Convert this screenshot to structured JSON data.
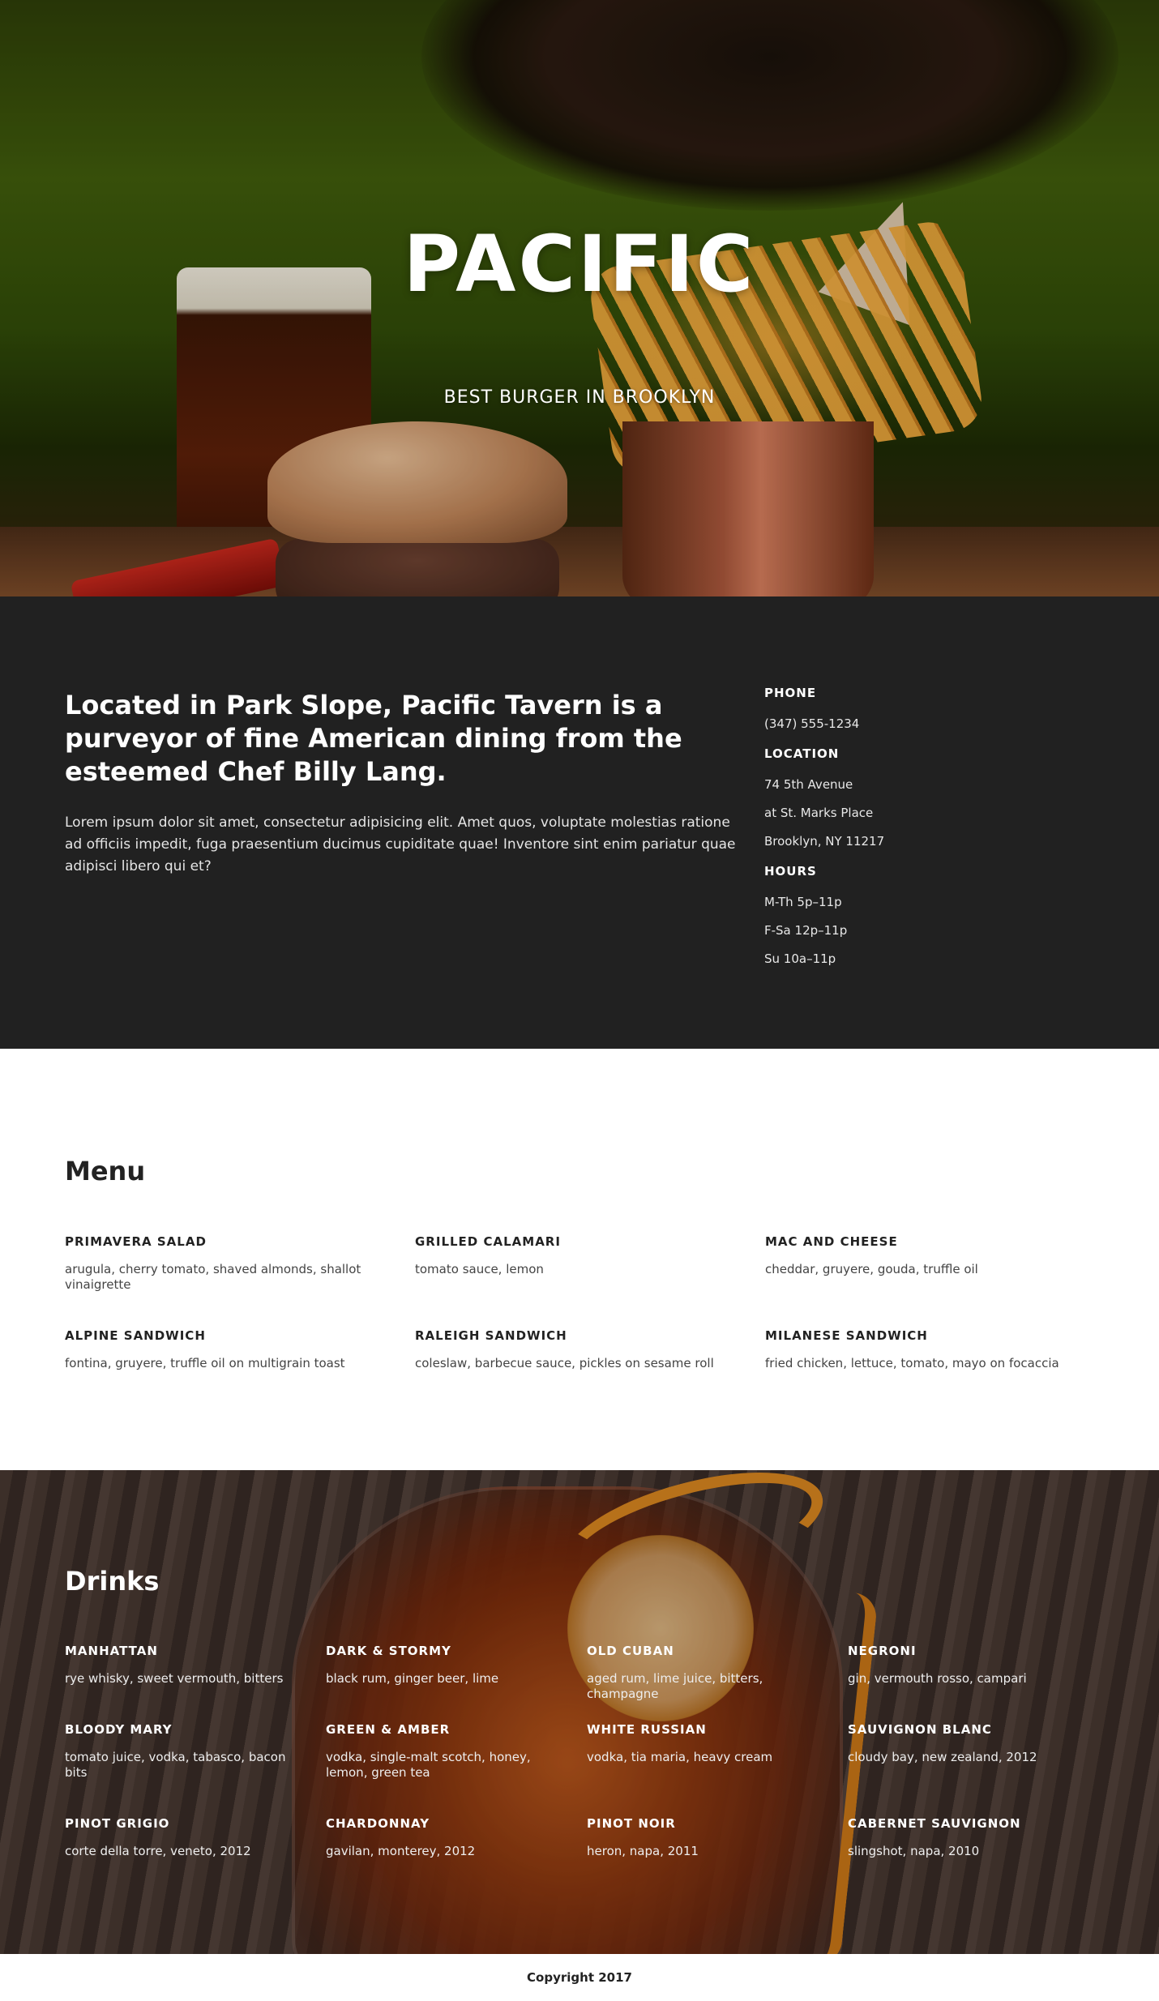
{
  "hero": {
    "title": "PACIFIC",
    "subtitle": "BEST BURGER IN BROOKLYN"
  },
  "about": {
    "headline": "Located in Park Slope, Pacific Tavern is a purveyor of fine American dining from the esteemed Chef Billy Lang.",
    "body": "Lorem ipsum dolor sit amet, consectetur adipisicing elit. Amet quos, voluptate molestias ratione ad officiis impedit, fuga praesentium ducimus cupiditate quae! Inventore sint enim pariatur quae adipisci libero qui et?",
    "phone_label": "PHONE",
    "phone": "(347) 555-1234",
    "location_label": "LOCATION",
    "location": [
      "74 5th Avenue",
      "at St. Marks Place",
      "Brooklyn, NY 11217"
    ],
    "hours_label": "HOURS",
    "hours": [
      "M-Th 5p–11p",
      "F-Sa 12p–11p",
      "Su 10a–11p"
    ]
  },
  "menu": {
    "title": "Menu",
    "items": [
      {
        "name": "PRIMAVERA SALAD",
        "desc": "arugula, cherry tomato, shaved almonds, shallot vinaigrette"
      },
      {
        "name": "GRILLED CALAMARI",
        "desc": "tomato sauce, lemon"
      },
      {
        "name": "MAC AND CHEESE",
        "desc": "cheddar, gruyere, gouda, truffle oil"
      },
      {
        "name": "ALPINE SANDWICH",
        "desc": "fontina, gruyere, truffle oil on multigrain toast"
      },
      {
        "name": "RALEIGH SANDWICH",
        "desc": "coleslaw, barbecue sauce, pickles on sesame roll"
      },
      {
        "name": "MILANESE SANDWICH",
        "desc": "fried chicken, lettuce, tomato, mayo on focaccia"
      }
    ]
  },
  "drinks": {
    "title": "Drinks",
    "items": [
      {
        "name": "MANHATTAN",
        "desc": "rye whisky, sweet vermouth, bitters"
      },
      {
        "name": "DARK & STORMY",
        "desc": "black rum, ginger beer, lime"
      },
      {
        "name": "OLD CUBAN",
        "desc": "aged rum, lime juice, bitters, champagne"
      },
      {
        "name": "NEGRONI",
        "desc": "gin, vermouth rosso, campari"
      },
      {
        "name": "BLOODY MARY",
        "desc": "tomato juice, vodka, tabasco, bacon bits"
      },
      {
        "name": "GREEN & AMBER",
        "desc": "vodka, single-malt scotch, honey, lemon, green tea"
      },
      {
        "name": "WHITE RUSSIAN",
        "desc": "vodka, tia maria, heavy cream"
      },
      {
        "name": "SAUVIGNON BLANC",
        "desc": "cloudy bay, new zealand, 2012"
      },
      {
        "name": "PINOT GRIGIO",
        "desc": "corte della torre, veneto, 2012"
      },
      {
        "name": "CHARDONNAY",
        "desc": "gavilan, monterey, 2012"
      },
      {
        "name": "PINOT NOIR",
        "desc": "heron, napa, 2011"
      },
      {
        "name": "CABERNET SAUVIGNON",
        "desc": "slingshot, napa, 2010"
      }
    ]
  },
  "footer": {
    "copyright": "Copyright 2017"
  }
}
